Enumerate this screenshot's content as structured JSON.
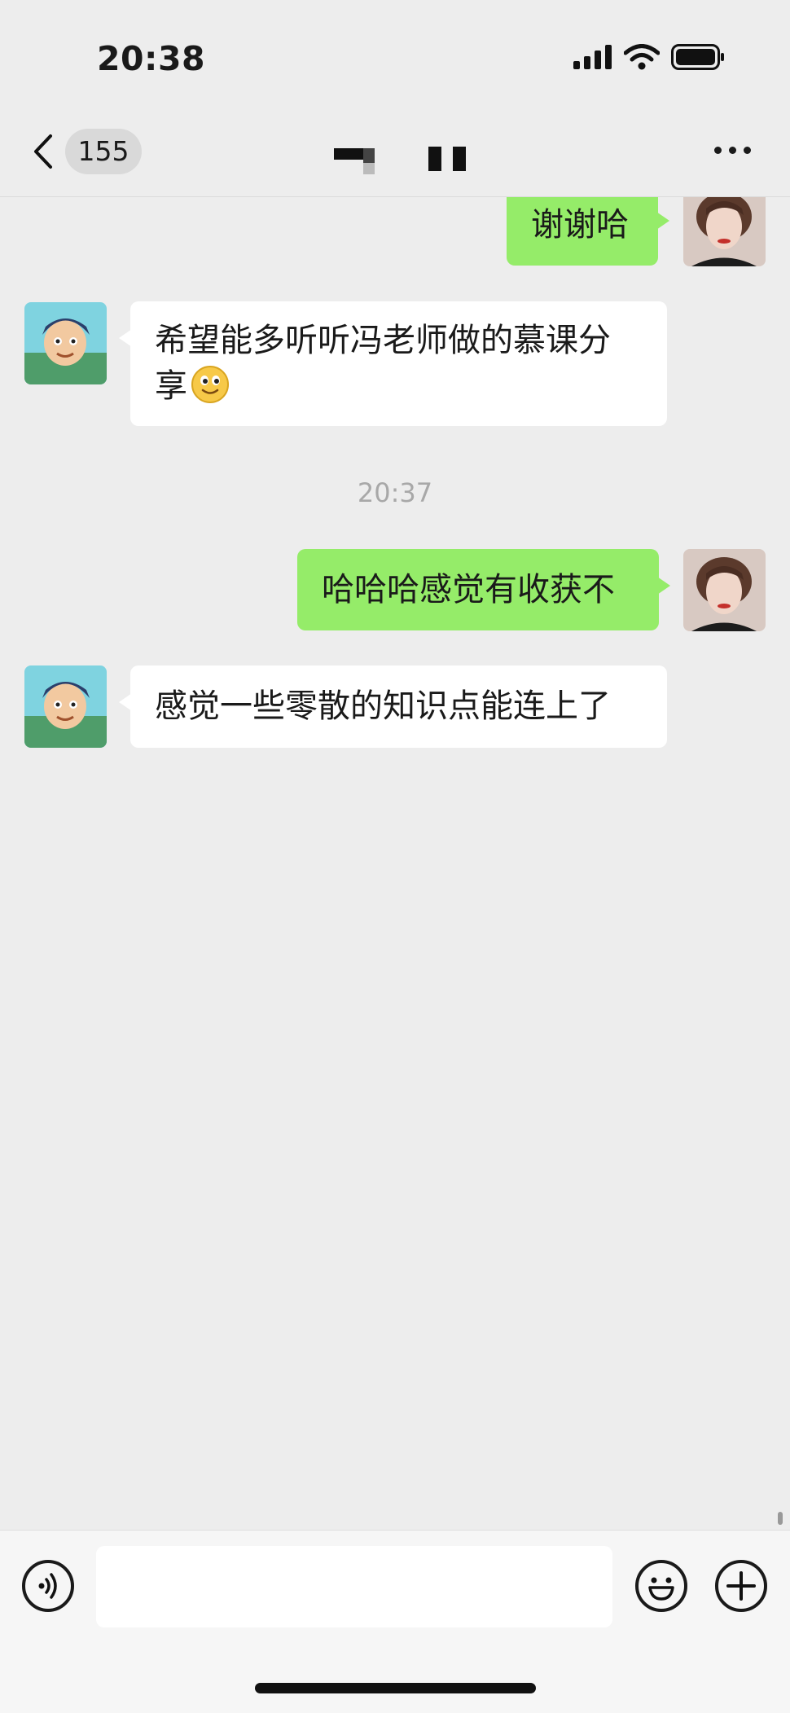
{
  "status_bar": {
    "time": "20:38"
  },
  "nav": {
    "unread_count": "155"
  },
  "messages": [
    {
      "side": "me",
      "text": "谢谢哈"
    },
    {
      "side": "them",
      "text_line1": "希望能多听听冯老师做的慕课分",
      "text_line2": "享"
    },
    {
      "side": "me",
      "text": "哈哈哈感觉有收获不"
    },
    {
      "side": "them",
      "text": "感觉一些零散的知识点能连上了"
    }
  ],
  "timestamp": "20:37",
  "colors": {
    "my_bubble": "#95ec69",
    "their_bubble": "#ffffff",
    "background": "#ededed"
  },
  "icons": [
    "back-chevron-icon",
    "more-icon",
    "voice-icon",
    "emoji-icon",
    "plus-icon",
    "smile-emoji-icon",
    "signal-icon",
    "wifi-icon",
    "battery-icon"
  ]
}
